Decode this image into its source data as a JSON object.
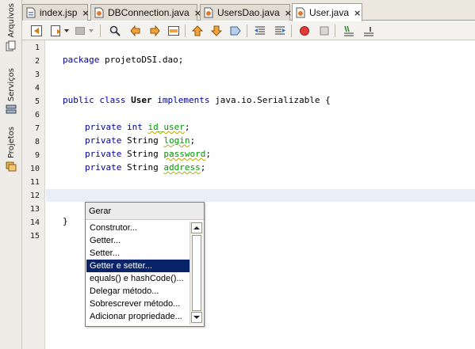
{
  "sidebar": {
    "tabs": [
      {
        "label": "Arquivos",
        "icon": "files-icon"
      },
      {
        "label": "Serviços",
        "icon": "services-icon"
      },
      {
        "label": "Projetos",
        "icon": "projects-icon"
      }
    ]
  },
  "tabs": [
    {
      "label": "index.jsp",
      "close": "×",
      "active": false
    },
    {
      "label": "DBConnection.java",
      "close": "×",
      "active": false
    },
    {
      "label": "UsersDao.java",
      "close": "×",
      "active": false
    },
    {
      "label": "User.java",
      "close": "×",
      "active": true
    }
  ],
  "toolbar": {
    "icons": [
      "back-icon",
      "history-icon",
      "dropdown-icon",
      "forward-icon",
      "dropdown-icon",
      "find-icon",
      "find-previous-icon",
      "find-next-icon",
      "toggle-highlight-icon",
      "previous-bookmark-icon",
      "next-bookmark-icon",
      "toggle-bookmark-icon",
      "shift-left-icon",
      "shift-right-icon",
      "start-macro-icon",
      "stop-macro-icon",
      "comment-icon",
      "uncomment-icon"
    ]
  },
  "editor": {
    "line_numbers": [
      "1",
      "2",
      "3",
      "4",
      "5",
      "6",
      "7",
      "8",
      "9",
      "10",
      "11",
      "12",
      "13",
      "14",
      "15"
    ],
    "current_line": 12,
    "code": {
      "l2_kw": "package",
      "l2_rest": " projetoDSI.dao;",
      "l5_kw": "public class",
      "l5_cls": "User",
      "l5_kw2": "implements",
      "l5_rest": " java.io.Serializable {",
      "l7_kw": "private int",
      "l7_fld": "id_user",
      "l8_kw": "private",
      "l8_type": " String ",
      "l8_fld": "login",
      "l9_kw": "private",
      "l9_type": " String ",
      "l9_fld": "password",
      "l10_kw": "private",
      "l10_type": " String ",
      "l10_fld": "address",
      "semicolon": ";",
      "l14": "}"
    }
  },
  "popup": {
    "title": "Gerar",
    "items": [
      "Construtor...",
      "Getter...",
      "Setter...",
      "Getter e setter...",
      "equals() e hashCode()...",
      "Delegar método...",
      "Sobrescrever método...",
      "Adicionar propriedade..."
    ],
    "selected": "Getter e setter..."
  },
  "colors": {
    "keyword": "#00009a",
    "field": "#009900",
    "selection": "#0a246a",
    "current_line": "#e9eff8"
  }
}
